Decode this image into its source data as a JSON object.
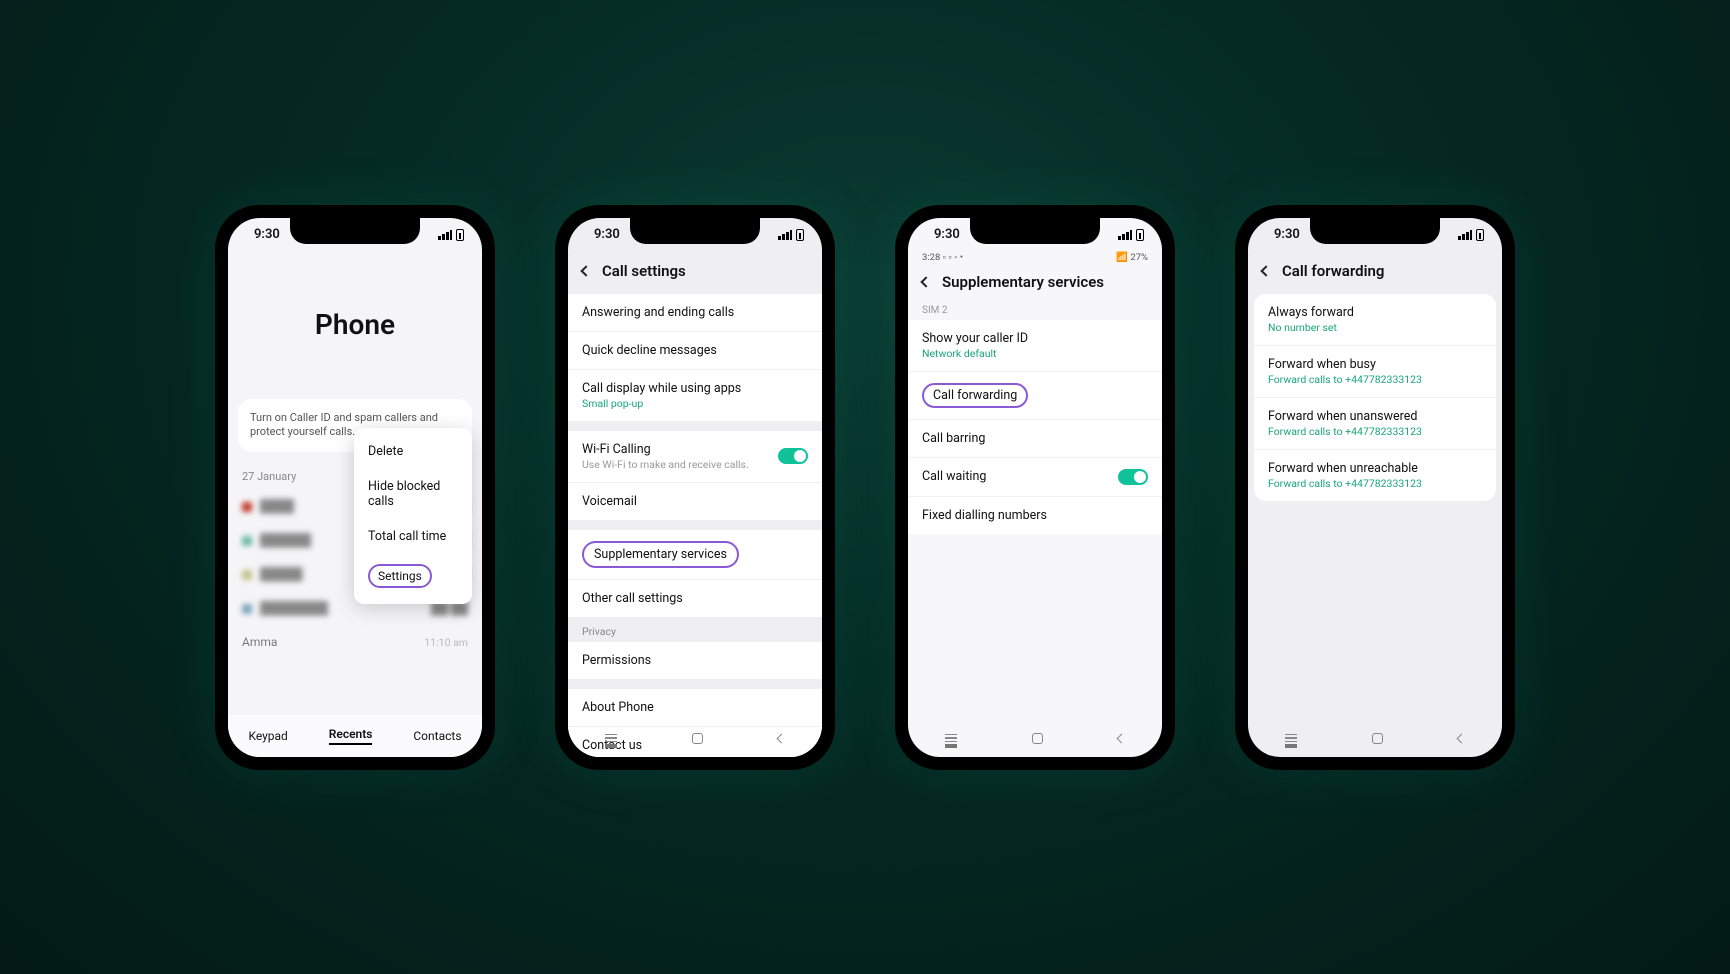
{
  "shared": {
    "time": "9:30"
  },
  "phone1": {
    "app_title": "Phone",
    "card_note": "Turn on Caller ID and spam callers and protect yourself calls.",
    "popup": {
      "delete": "Delete",
      "hide_blocked": "Hide blocked calls",
      "total_time": "Total call time",
      "settings": "Settings"
    },
    "date_header": "27 January",
    "recents": [
      {
        "name": "———",
        "time": "——",
        "color": "#c0392b"
      },
      {
        "name": "—————",
        "time": "——",
        "color": "#6bb9a0"
      },
      {
        "name": "————",
        "time": "——",
        "color": "#b9b98a"
      },
      {
        "name": "———————",
        "time": "——",
        "color": "#7aa3bd"
      },
      {
        "name": "Amma",
        "time": "11:10 am",
        "color": "#c44"
      }
    ],
    "tabs": {
      "keypad": "Keypad",
      "recents": "Recents",
      "contacts": "Contacts"
    }
  },
  "phone2": {
    "title": "Call settings",
    "items": {
      "answering": "Answering and ending calls",
      "decline": "Quick decline messages",
      "display": {
        "label": "Call display while using apps",
        "sub": "Small pop-up"
      },
      "wifi": {
        "label": "Wi-Fi Calling",
        "sub": "Use Wi-Fi to make and receive calls."
      },
      "voicemail": "Voicemail",
      "supplementary": "Supplementary services",
      "other": "Other call settings",
      "privacy_header": "Privacy",
      "permissions": "Permissions",
      "about": "About Phone",
      "contact": "Contact us"
    }
  },
  "phone3": {
    "inner_time": "3:28",
    "inner_batt": "27%",
    "title": "Supplementary services",
    "sim_label": "SIM 2",
    "items": {
      "caller_id": {
        "label": "Show your caller ID",
        "sub": "Network default"
      },
      "forwarding": "Call forwarding",
      "barring": "Call barring",
      "waiting": "Call waiting",
      "fixed": "Fixed dialling numbers"
    }
  },
  "phone4": {
    "title": "Call forwarding",
    "items": {
      "always": {
        "label": "Always forward",
        "sub": "No number set"
      },
      "busy": {
        "label": "Forward when busy",
        "sub": "Forward calls to +447782333123"
      },
      "unanswered": {
        "label": "Forward when unanswered",
        "sub": "Forward calls to +447782333123"
      },
      "unreachable": {
        "label": "Forward when unreachable",
        "sub": "Forward calls to +447782333123"
      }
    }
  }
}
